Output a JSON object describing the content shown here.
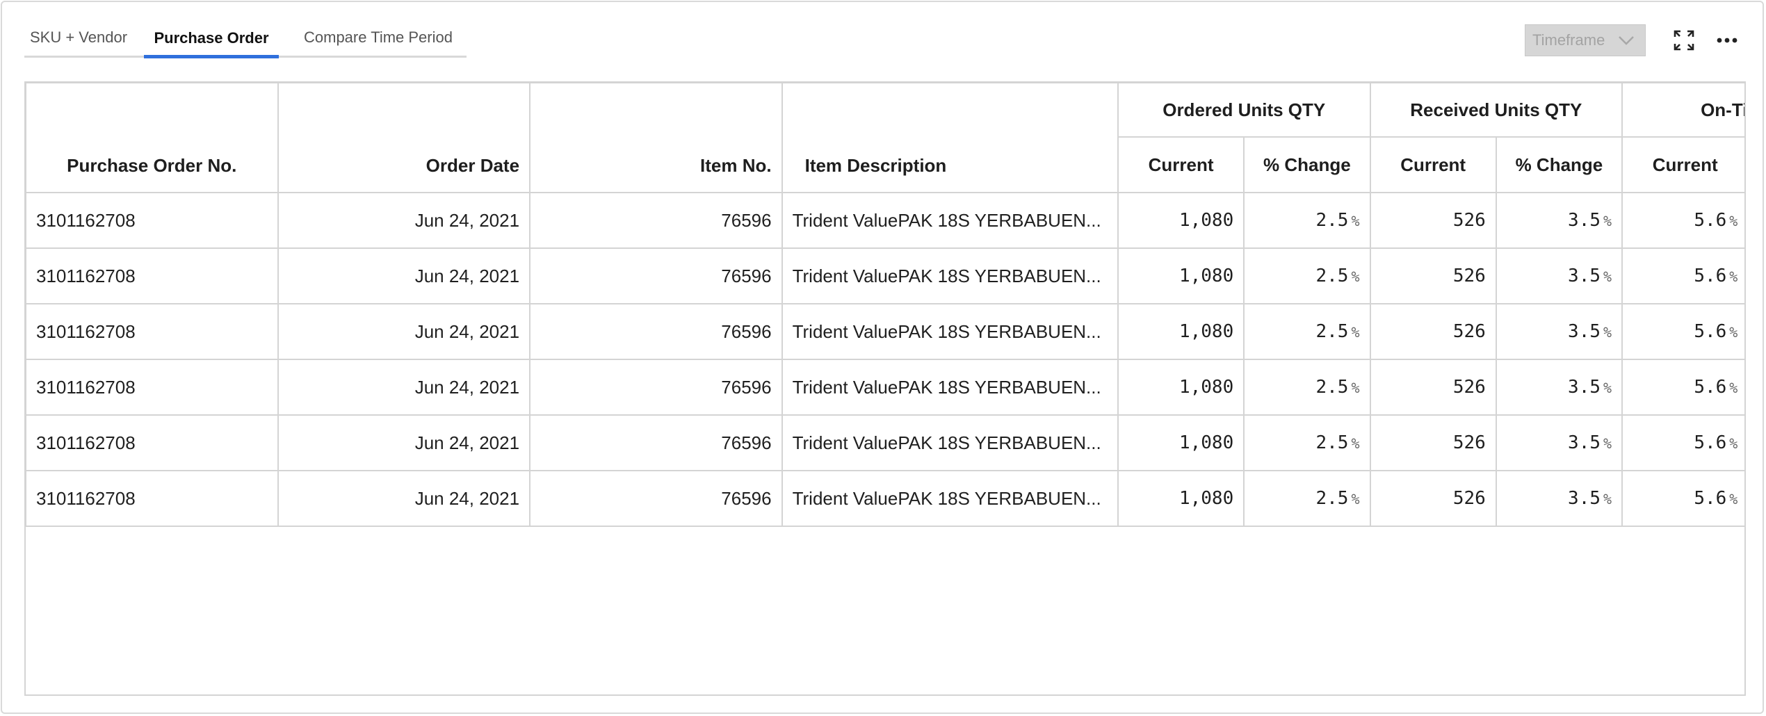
{
  "tabs": [
    {
      "label": "SKU + Vendor"
    },
    {
      "label": "Purchase Order"
    },
    {
      "label": "Compare Time Period"
    }
  ],
  "timeframe": {
    "label": "Timeframe",
    "icon": "chevron-down-icon"
  },
  "toolbar_icons": [
    "expand-icon",
    "more-icon"
  ],
  "table": {
    "headers": {
      "po_no": "Purchase Order No.",
      "order_date": "Order Date",
      "item_no": "Item No.",
      "item_desc": "Item Description",
      "group_ordered": "Ordered Units QTY",
      "group_received": "Received Units QTY",
      "group_ontime": "On-Tim",
      "current": "Current",
      "pct_change": "% Change"
    },
    "percent_symbol": "%",
    "rows": [
      {
        "po": "3101162708",
        "date": "Jun 24, 2021",
        "item": "76596",
        "desc": "Trident ValuePAK 18S YERBABUEN...",
        "ord_cur": "1,080",
        "ord_pct": "2.5",
        "rec_cur": "526",
        "rec_pct": "3.5",
        "ot_cur": "5.6"
      },
      {
        "po": "3101162708",
        "date": "Jun 24, 2021",
        "item": "76596",
        "desc": "Trident ValuePAK 18S YERBABUEN...",
        "ord_cur": "1,080",
        "ord_pct": "2.5",
        "rec_cur": "526",
        "rec_pct": "3.5",
        "ot_cur": "5.6"
      },
      {
        "po": "3101162708",
        "date": "Jun 24, 2021",
        "item": "76596",
        "desc": "Trident ValuePAK 18S YERBABUEN...",
        "ord_cur": "1,080",
        "ord_pct": "2.5",
        "rec_cur": "526",
        "rec_pct": "3.5",
        "ot_cur": "5.6"
      },
      {
        "po": "3101162708",
        "date": "Jun 24, 2021",
        "item": "76596",
        "desc": "Trident ValuePAK 18S YERBABUEN...",
        "ord_cur": "1,080",
        "ord_pct": "2.5",
        "rec_cur": "526",
        "rec_pct": "3.5",
        "ot_cur": "5.6"
      },
      {
        "po": "3101162708",
        "date": "Jun 24, 2021",
        "item": "76596",
        "desc": "Trident ValuePAK 18S YERBABUEN...",
        "ord_cur": "1,080",
        "ord_pct": "2.5",
        "rec_cur": "526",
        "rec_pct": "3.5",
        "ot_cur": "5.6"
      },
      {
        "po": "3101162708",
        "date": "Jun 24, 2021",
        "item": "76596",
        "desc": "Trident ValuePAK 18S YERBABUEN...",
        "ord_cur": "1,080",
        "ord_pct": "2.5",
        "rec_cur": "526",
        "rec_pct": "3.5",
        "ot_cur": "5.6"
      }
    ]
  }
}
